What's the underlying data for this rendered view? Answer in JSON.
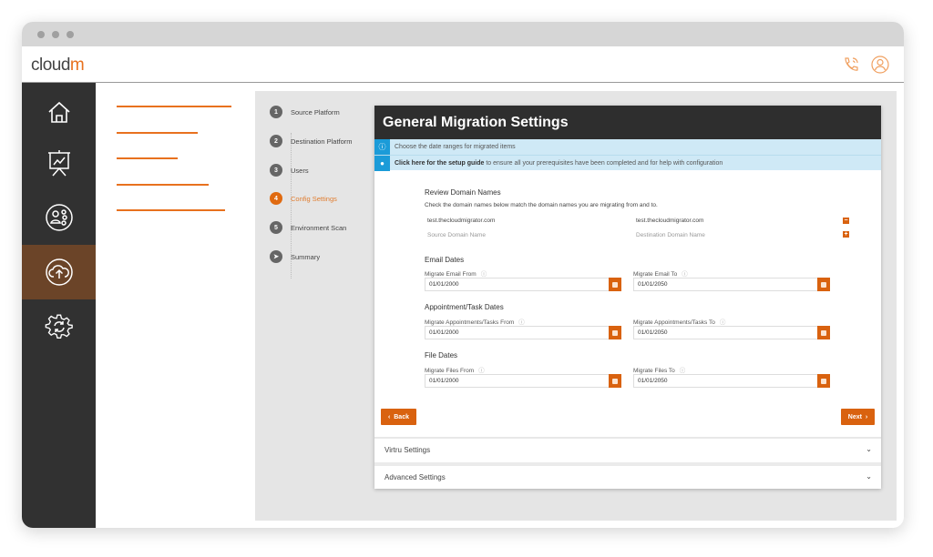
{
  "brand": {
    "name_a": "cloud",
    "name_b": "m",
    "accent": "#e8711e"
  },
  "header": {
    "icons": [
      "phone-icon",
      "user-circle-icon"
    ]
  },
  "sidebar": {
    "items": [
      {
        "icon": "home-icon"
      },
      {
        "icon": "presentation-icon"
      },
      {
        "icon": "users-icon"
      },
      {
        "icon": "cloud-upload-icon",
        "active": true
      },
      {
        "icon": "gear-sync-icon"
      }
    ]
  },
  "steps": [
    {
      "num": "1",
      "label": "Source Platform"
    },
    {
      "num": "2",
      "label": "Destination Platform"
    },
    {
      "num": "3",
      "label": "Users"
    },
    {
      "num": "4",
      "label": "Config Settings",
      "active": true
    },
    {
      "num": "5",
      "label": "Environment Scan"
    },
    {
      "num": "",
      "label": "Summary"
    }
  ],
  "card": {
    "title": "General Migration Settings",
    "info1": "Choose the date ranges for migrated items",
    "info2_link": "Click here for the setup guide",
    "info2_rest": " to ensure all your prerequisites have been completed and for help with configuration",
    "domains": {
      "title": "Review Domain Names",
      "desc": "Check the domain names below match the domain names you are migrating from and to.",
      "source_value": "test.thecloudmigrator.com",
      "dest_value": "test.thecloudmigrator.com",
      "source_placeholder": "Source Domain Name",
      "dest_placeholder": "Destination Domain Name"
    },
    "email": {
      "title": "Email Dates",
      "from_label": "Migrate Email From",
      "to_label": "Migrate Email To",
      "from": "01/01/2000",
      "to": "01/01/2050"
    },
    "appt": {
      "title": "Appointment/Task Dates",
      "from_label": "Migrate Appointments/Tasks From",
      "to_label": "Migrate Appointments/Tasks To",
      "from": "01/01/2000",
      "to": "01/01/2050"
    },
    "files": {
      "title": "File Dates",
      "from_label": "Migrate Files From",
      "to_label": "Migrate Files To",
      "from": "01/01/2000",
      "to": "01/01/2050"
    },
    "back": "Back",
    "next": "Next",
    "virtru": "Virtru Settings",
    "advanced": "Advanced Settings"
  }
}
